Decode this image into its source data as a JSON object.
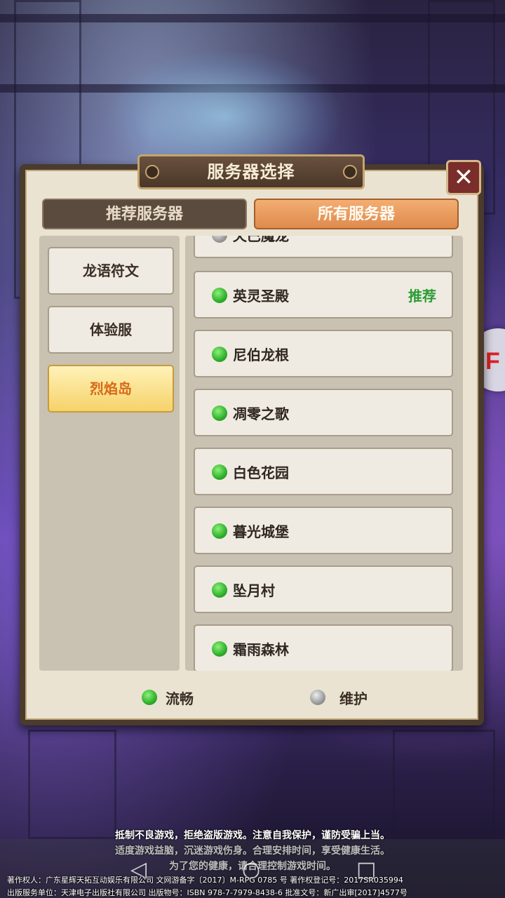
{
  "dialog": {
    "title": "服务器选择",
    "close_symbol": "✕"
  },
  "tabs": {
    "recommended": "推荐服务器",
    "all": "所有服务器"
  },
  "regions": [
    {
      "label": "龙语符文",
      "selected": false
    },
    {
      "label": "体验服",
      "selected": false
    },
    {
      "label": "烈焰岛",
      "selected": true
    }
  ],
  "servers": [
    {
      "name": "夭巴魔龙",
      "status": "maintenance",
      "tag": ""
    },
    {
      "name": "英灵圣殿",
      "status": "smooth",
      "tag": "推荐"
    },
    {
      "name": "尼伯龙根",
      "status": "smooth",
      "tag": ""
    },
    {
      "name": "凋零之歌",
      "status": "smooth",
      "tag": ""
    },
    {
      "name": "白色花园",
      "status": "smooth",
      "tag": ""
    },
    {
      "name": "暮光城堡",
      "status": "smooth",
      "tag": ""
    },
    {
      "name": "坠月村",
      "status": "smooth",
      "tag": ""
    },
    {
      "name": "霜雨森林",
      "status": "smooth",
      "tag": ""
    }
  ],
  "legend": {
    "smooth": "流畅",
    "maintenance": "维护"
  },
  "colors": {
    "status_smooth": "#2fb02a",
    "status_maintenance": "#9a9a9a",
    "recommend_tag": "#2b9c35",
    "active_tab": "#df8a4d",
    "selected_region": "#f6d26a"
  },
  "notice": {
    "line1": "抵制不良游戏，拒绝盗版游戏。注意自我保护，谨防受骗上当。",
    "line2": "适度游戏益脑，沉迷游戏伤身。合理安排时间，享受健康生活。",
    "line3": "为了您的健康，请合理控制游戏时间。"
  },
  "copyright": {
    "line1": "著作权人：广东星辉天拓互动娱乐有限公司 文网游备字〔2017〕M-RPG 0785 号 著作权登记号：2017SR035994",
    "line2": "出版服务单位：天津电子出版社有限公司 出版物号：ISBN 978-7-7979-8438-6 批准文号：新广出审[2017]4577号"
  }
}
